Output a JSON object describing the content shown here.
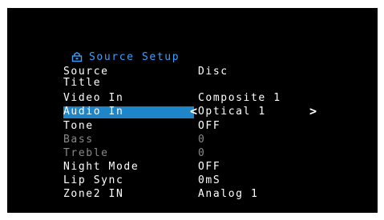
{
  "header": {
    "title": "Source Setup",
    "icon": "source-setup-icon"
  },
  "rows": [
    {
      "label": "Source",
      "value": "Disc"
    },
    {
      "label": "Title",
      "value": ""
    },
    {
      "label": "Video In",
      "value": "Composite 1"
    },
    {
      "label": "Audio In",
      "value": "Optical 1"
    },
    {
      "label": "Tone",
      "value": "OFF"
    },
    {
      "label": "Bass",
      "value": "0"
    },
    {
      "label": "Treble",
      "value": "0"
    },
    {
      "label": "Night Mode",
      "value": "OFF"
    },
    {
      "label": "Lip Sync",
      "value": "0mS"
    },
    {
      "label": "Zone2 IN",
      "value": "Analog 1"
    }
  ],
  "selected_row": "Audio In",
  "arrows": {
    "left": "<",
    "right": ">"
  },
  "colors": {
    "background": "#000000",
    "text": "#ffffff",
    "highlight": "#1e86c8",
    "header": "#3aa0ff",
    "disabled": "#8a8a8a"
  }
}
